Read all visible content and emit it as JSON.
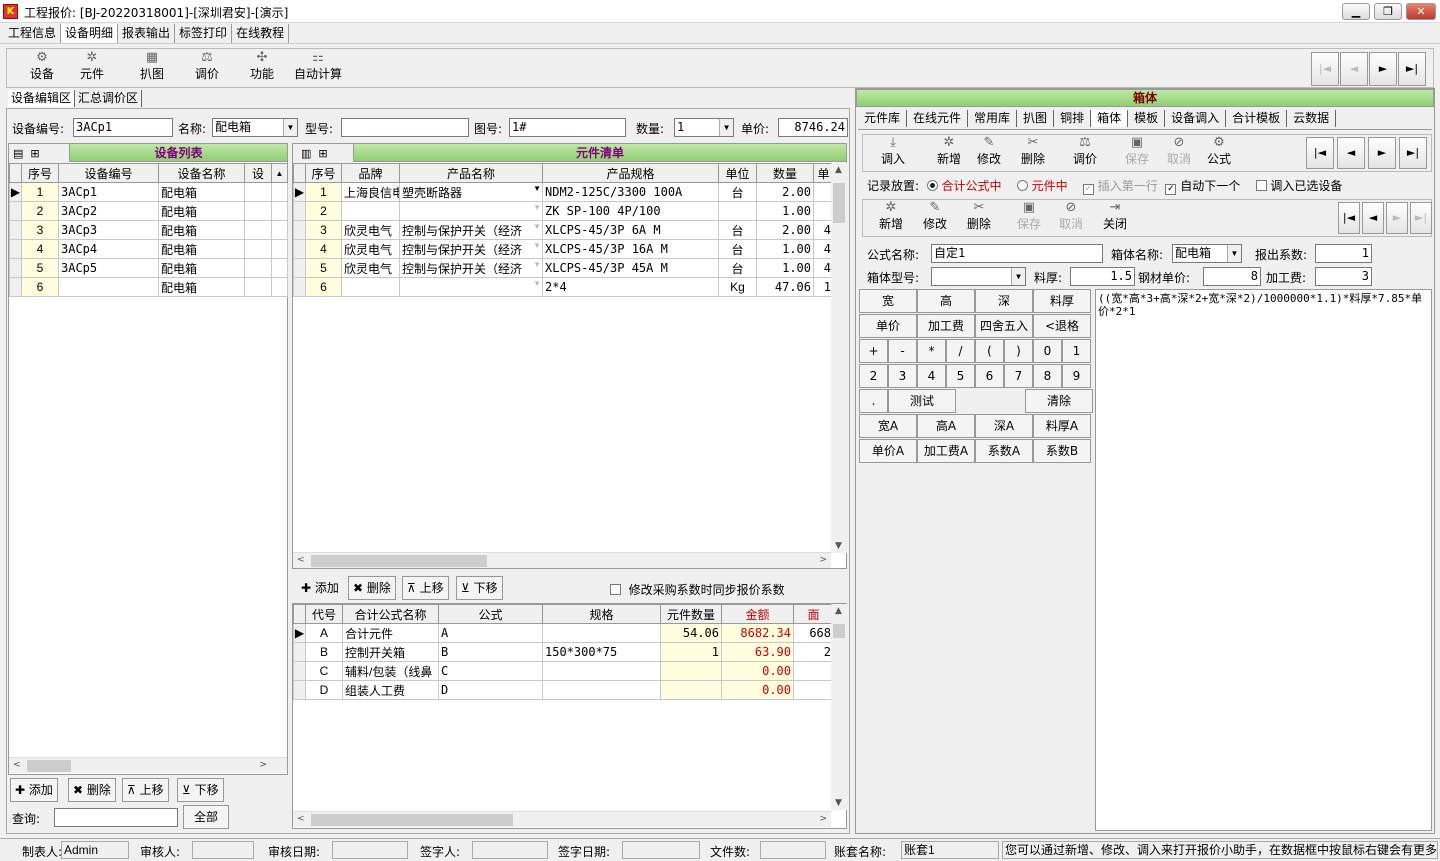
{
  "window": {
    "title": "工程报价: [BJ-20220318001]-[深圳君安]-[演示]",
    "logo": "K"
  },
  "menu": [
    "工程信息",
    "设备明细",
    "报表输出",
    "标签打印",
    "在线教程"
  ],
  "toolbar": [
    {
      "label": "设备",
      "icon": "device-icon"
    },
    {
      "label": "元件",
      "icon": "component-icon"
    },
    {
      "label": "扒图",
      "icon": "grab-icon"
    },
    {
      "label": "调价",
      "icon": "price-icon"
    },
    {
      "label": "功能",
      "icon": "function-icon"
    },
    {
      "label": "自动计算",
      "icon": "calc-icon"
    }
  ],
  "nav": [
    "|◄",
    "◄",
    "►",
    "►|"
  ],
  "leftTabs": [
    "设备编辑区",
    "汇总调价区"
  ],
  "deviceForm": {
    "code_label": "设备编号:",
    "code": "3ACp1",
    "name_label": "名称:",
    "name": "配电箱",
    "model_label": "型号:",
    "model": "",
    "drawing_label": "图号:",
    "drawing": "1#",
    "qty_label": "数量:",
    "qty": "1",
    "price_label": "单价:",
    "price": "8746.24"
  },
  "deviceList": {
    "title": "设备列表",
    "headers": [
      "序号",
      "设备编号",
      "设备名称",
      "设"
    ],
    "rows": [
      [
        "1",
        "3ACp1",
        "配电箱"
      ],
      [
        "2",
        "3ACp2",
        "配电箱"
      ],
      [
        "3",
        "3ACp3",
        "配电箱"
      ],
      [
        "4",
        "3ACp4",
        "配电箱"
      ],
      [
        "5",
        "3ACp5",
        "配电箱"
      ],
      [
        "6",
        "",
        "配电箱"
      ]
    ],
    "buttons": [
      "添加",
      "删除",
      "上移",
      "下移"
    ],
    "query_label": "查询:",
    "query_value": "",
    "all_label": "全部"
  },
  "compList": {
    "title": "元件清单",
    "headers": [
      "序号",
      "品牌",
      "产品名称",
      "产品规格",
      "单位",
      "数量",
      "单"
    ],
    "rows": [
      [
        "1",
        "上海良信电",
        "塑壳断路器",
        "NDM2-125C/3300 100A",
        "台",
        "2.00",
        ""
      ],
      [
        "2",
        "",
        "",
        "ZK SP-100 4P/100",
        "",
        "1.00",
        ""
      ],
      [
        "3",
        "欣灵电气",
        "控制与保护开关（经济",
        "XLCPS-45/3P 6A M",
        "台",
        "2.00",
        "4"
      ],
      [
        "4",
        "欣灵电气",
        "控制与保护开关（经济",
        "XLCPS-45/3P 16A M",
        "台",
        "1.00",
        "4"
      ],
      [
        "5",
        "欣灵电气",
        "控制与保护开关（经济",
        "XLCPS-45/3P 45A M",
        "台",
        "1.00",
        "4"
      ],
      [
        "6",
        "",
        "",
        "2*4",
        "Kg",
        "47.06",
        "1"
      ]
    ]
  },
  "formulaBar": {
    "buttons": [
      "添加",
      "删除",
      "上移",
      "下移"
    ],
    "sync_label": "修改采购系数时同步报价系数"
  },
  "formulaGrid": {
    "headers": [
      "代号",
      "合计公式名称",
      "公式",
      "规格",
      "元件数量",
      "金额",
      "面"
    ],
    "rows": [
      [
        "A",
        "合计元件",
        "A",
        "",
        "54.06",
        "8682.34",
        "668"
      ],
      [
        "B",
        "控制开关箱",
        "B",
        "150*300*75",
        "1",
        "63.90",
        "2"
      ],
      [
        "C",
        "辅料/包装（线鼻",
        "C",
        "",
        "",
        "0.00",
        ""
      ],
      [
        "D",
        "组装人工费",
        "D",
        "",
        "",
        "0.00",
        ""
      ]
    ]
  },
  "rightTabs": [
    "元件库",
    "在线元件",
    "常用库",
    "扒图",
    "铜排",
    "箱体",
    "模板",
    "设备调入",
    "合计模板",
    "云数据"
  ],
  "boxTitle": "箱体",
  "rightToolbar1": [
    "调入",
    "新增",
    "修改",
    "删除",
    "调价",
    "保存",
    "取消",
    "公式"
  ],
  "recordPlace": {
    "label": "记录放置:",
    "opt1": "合计公式中",
    "opt2": "元件中",
    "chk1": "插入第一行",
    "chk2": "自动下一个",
    "chk3": "调入已选设备"
  },
  "rightToolbar2": [
    "新增",
    "修改",
    "删除",
    "保存",
    "取消",
    "关闭"
  ],
  "formulaForm": {
    "name_label": "公式名称:",
    "name": "自定1",
    "box_label": "箱体名称:",
    "box": "配电箱",
    "coef_label": "报出系数:",
    "coef": "1",
    "type_label": "箱体型号:",
    "type": "",
    "thick_label": "料厚:",
    "thick": "1.5",
    "steel_label": "钢材单价:",
    "steel": "8",
    "proc_label": "加工费:",
    "proc": "3"
  },
  "keypad": {
    "row1": [
      "宽",
      "高",
      "深",
      "料厚"
    ],
    "row2": [
      "单价",
      "加工费",
      "四舍五入",
      "<退格"
    ],
    "row3": [
      "+",
      "-",
      "*",
      "/",
      "(",
      ")",
      "0",
      "1"
    ],
    "row4": [
      "2",
      "3",
      "4",
      "5",
      "6",
      "7",
      "8",
      "9"
    ],
    "row5": [
      ".",
      "测试",
      "清除"
    ],
    "row6": [
      "宽A",
      "高A",
      "深A",
      "料厚A"
    ],
    "row7": [
      "单价A",
      "加工费A",
      "系数A",
      "系数B"
    ]
  },
  "formulaText": "((宽*高*3+高*深*2+宽*深*2)/1000000*1.1)*料厚*7.85*单价*2*1",
  "status": {
    "maker_label": "制表人:",
    "maker": "Admin",
    "checker_label": "审核人:",
    "checker": "",
    "checkdate_label": "审核日期:",
    "checkdate": "",
    "signer_label": "签字人:",
    "signer": "",
    "signdate_label": "签字日期:",
    "signdate": "",
    "files_label": "文件数:",
    "files": "",
    "account_label": "账套名称:",
    "account": "账套1",
    "hint": "您可以通过新增、修改、调入来打开报价小助手，在数据框中按鼠标右键会有更多功能"
  }
}
